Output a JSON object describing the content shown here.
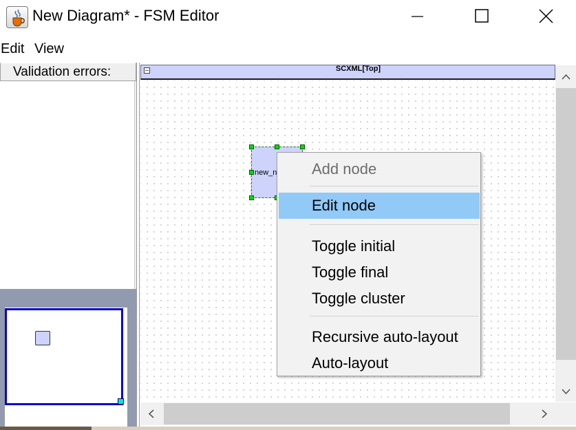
{
  "window": {
    "title": "New Diagram* - FSM Editor",
    "app_icon": "java-cup-icon",
    "controls": [
      "minimize-icon",
      "maximize-icon",
      "close-icon"
    ]
  },
  "menubar": {
    "items": [
      {
        "label": "Edit"
      },
      {
        "label": "View"
      }
    ]
  },
  "left_panel": {
    "validation_header": "Validation errors:"
  },
  "graph": {
    "title": "SCXML[Top]",
    "node_label": "new_n"
  },
  "context_menu": {
    "items": [
      {
        "label": "Add node",
        "enabled": false
      },
      {
        "label": "Edit node",
        "enabled": true,
        "highlighted": true
      },
      {
        "label": "Toggle initial",
        "enabled": true
      },
      {
        "label": "Toggle final",
        "enabled": true
      },
      {
        "label": "Toggle cluster",
        "enabled": true
      },
      {
        "label": "Recursive auto-layout",
        "enabled": true
      },
      {
        "label": "Auto-layout",
        "enabled": true
      }
    ]
  },
  "colors": {
    "node_fill": "#cdd3fb",
    "highlight": "#91c9f7",
    "overview_border": "#0000cc",
    "handle": "#00dd00"
  }
}
